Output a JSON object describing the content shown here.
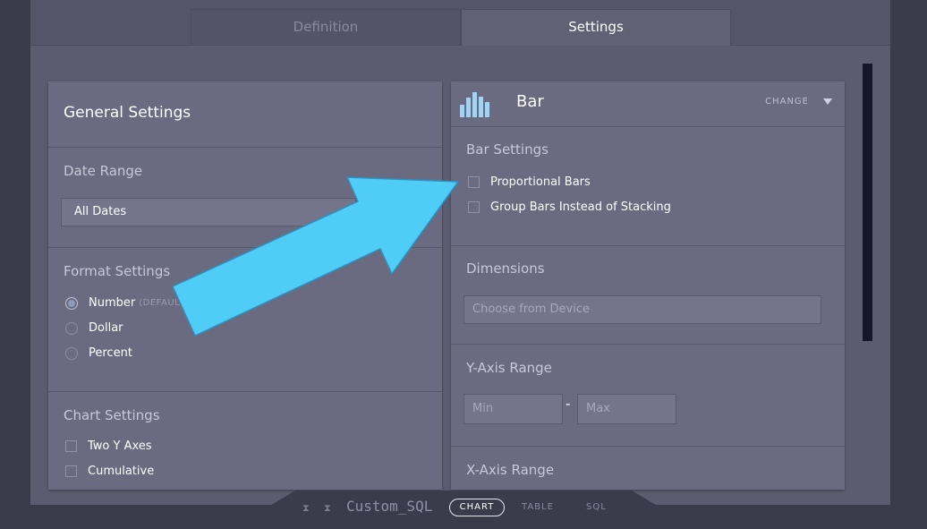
{
  "tabs": {
    "definition": "Definition",
    "settings": "Settings"
  },
  "general": {
    "title": "General Settings",
    "date_range": {
      "label": "Date Range",
      "value": "All Dates"
    },
    "format": {
      "label": "Format Settings",
      "options": [
        "Number",
        "Dollar",
        "Percent"
      ],
      "default_tag": "(DEFAULT)",
      "selected": "Number"
    },
    "chart": {
      "label": "Chart Settings",
      "options": [
        "Two Y Axes",
        "Cumulative"
      ]
    }
  },
  "chart_type": {
    "name": "Bar",
    "change_label": "CHANGE",
    "bar_settings": {
      "label": "Bar Settings",
      "options": [
        "Proportional Bars",
        "Group Bars Instead of Stacking"
      ]
    },
    "dimensions": {
      "label": "Dimensions",
      "placeholder": "Choose from Device"
    },
    "y_axis": {
      "label": "Y-Axis Range",
      "min_placeholder": "Min",
      "max_placeholder": "Max",
      "separator": "-"
    },
    "x_axis": {
      "label": "X-Axis Range"
    }
  },
  "footer": {
    "title": "Custom_SQL",
    "chart_label": "CHART",
    "table_label": "TABLE",
    "sql_label": "SQL"
  },
  "colors": {
    "accent_arrow": "#4fcdf6",
    "bar_icon": "#9fd4f5"
  }
}
